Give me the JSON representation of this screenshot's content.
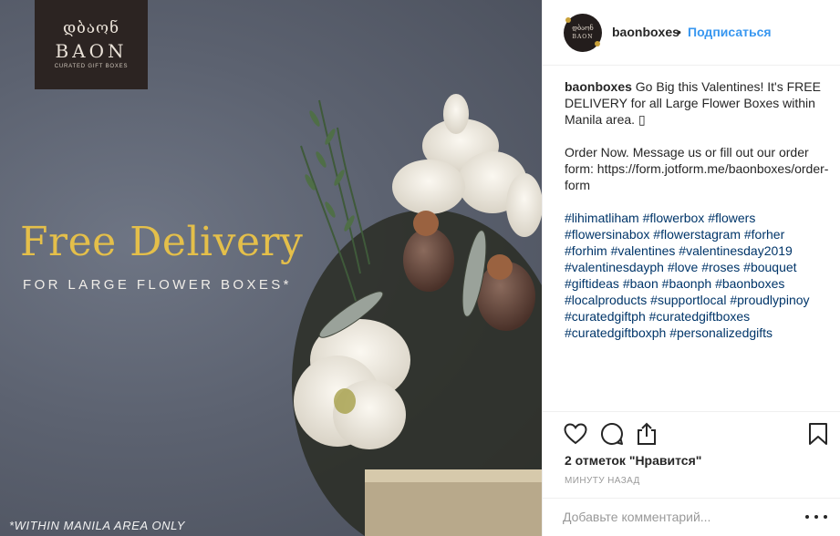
{
  "image": {
    "logo_script": "დბაონ",
    "logo_word": "BAON",
    "logo_tagline": "CURATED GIFT BOXES",
    "headline": "Free Delivery",
    "subline": "FOR LARGE FLOWER BOXES*",
    "footnote": "*WITHIN MANILA AREA ONLY"
  },
  "header": {
    "avatar_script": "დბაონ",
    "avatar_word": "BAON",
    "username": "baonboxes",
    "separator": "•",
    "follow_label": "Подписаться"
  },
  "caption": {
    "username": "baonboxes",
    "text": "Go Big this Valentines! It's FREE DELIVERY for all Large Flower Boxes within Manila area. ",
    "emoji": "▯",
    "order_text": "Order Now. Message us or fill out our order form: https://form.jotform.me/baonboxes/order-form",
    "hashtags": [
      "#lihimatliham",
      "#flowerbox",
      "#flowers",
      "#flowersinabox",
      "#flowerstagram",
      "#forher",
      "#forhim",
      "#valentines",
      "#valentinesday2019",
      "#valentinesdayph",
      "#love",
      "#roses",
      "#bouquet",
      "#giftideas",
      "#baon",
      "#baonph",
      "#baonboxes",
      "#localproducts",
      "#supportlocal",
      "#proudlypinoy",
      "#curatedgiftph",
      "#curatedgiftboxes",
      "#curatedgiftboxph",
      "#personalizedgifts"
    ]
  },
  "actions": {
    "like_icon": "heart-icon",
    "comment_icon": "comment-icon",
    "share_icon": "share-icon",
    "save_icon": "bookmark-icon"
  },
  "likes_text": "2 отметок \"Нравится\"",
  "timestamp": "МИНУТУ НАЗАД",
  "comment": {
    "placeholder": "Добавьте комментарий...",
    "more_icon": "more-icon"
  },
  "colors": {
    "link_blue": "#3897f0",
    "hashtag": "#003569",
    "headline_gold": "#e4bf4a",
    "logo_bg": "#2c2422"
  }
}
